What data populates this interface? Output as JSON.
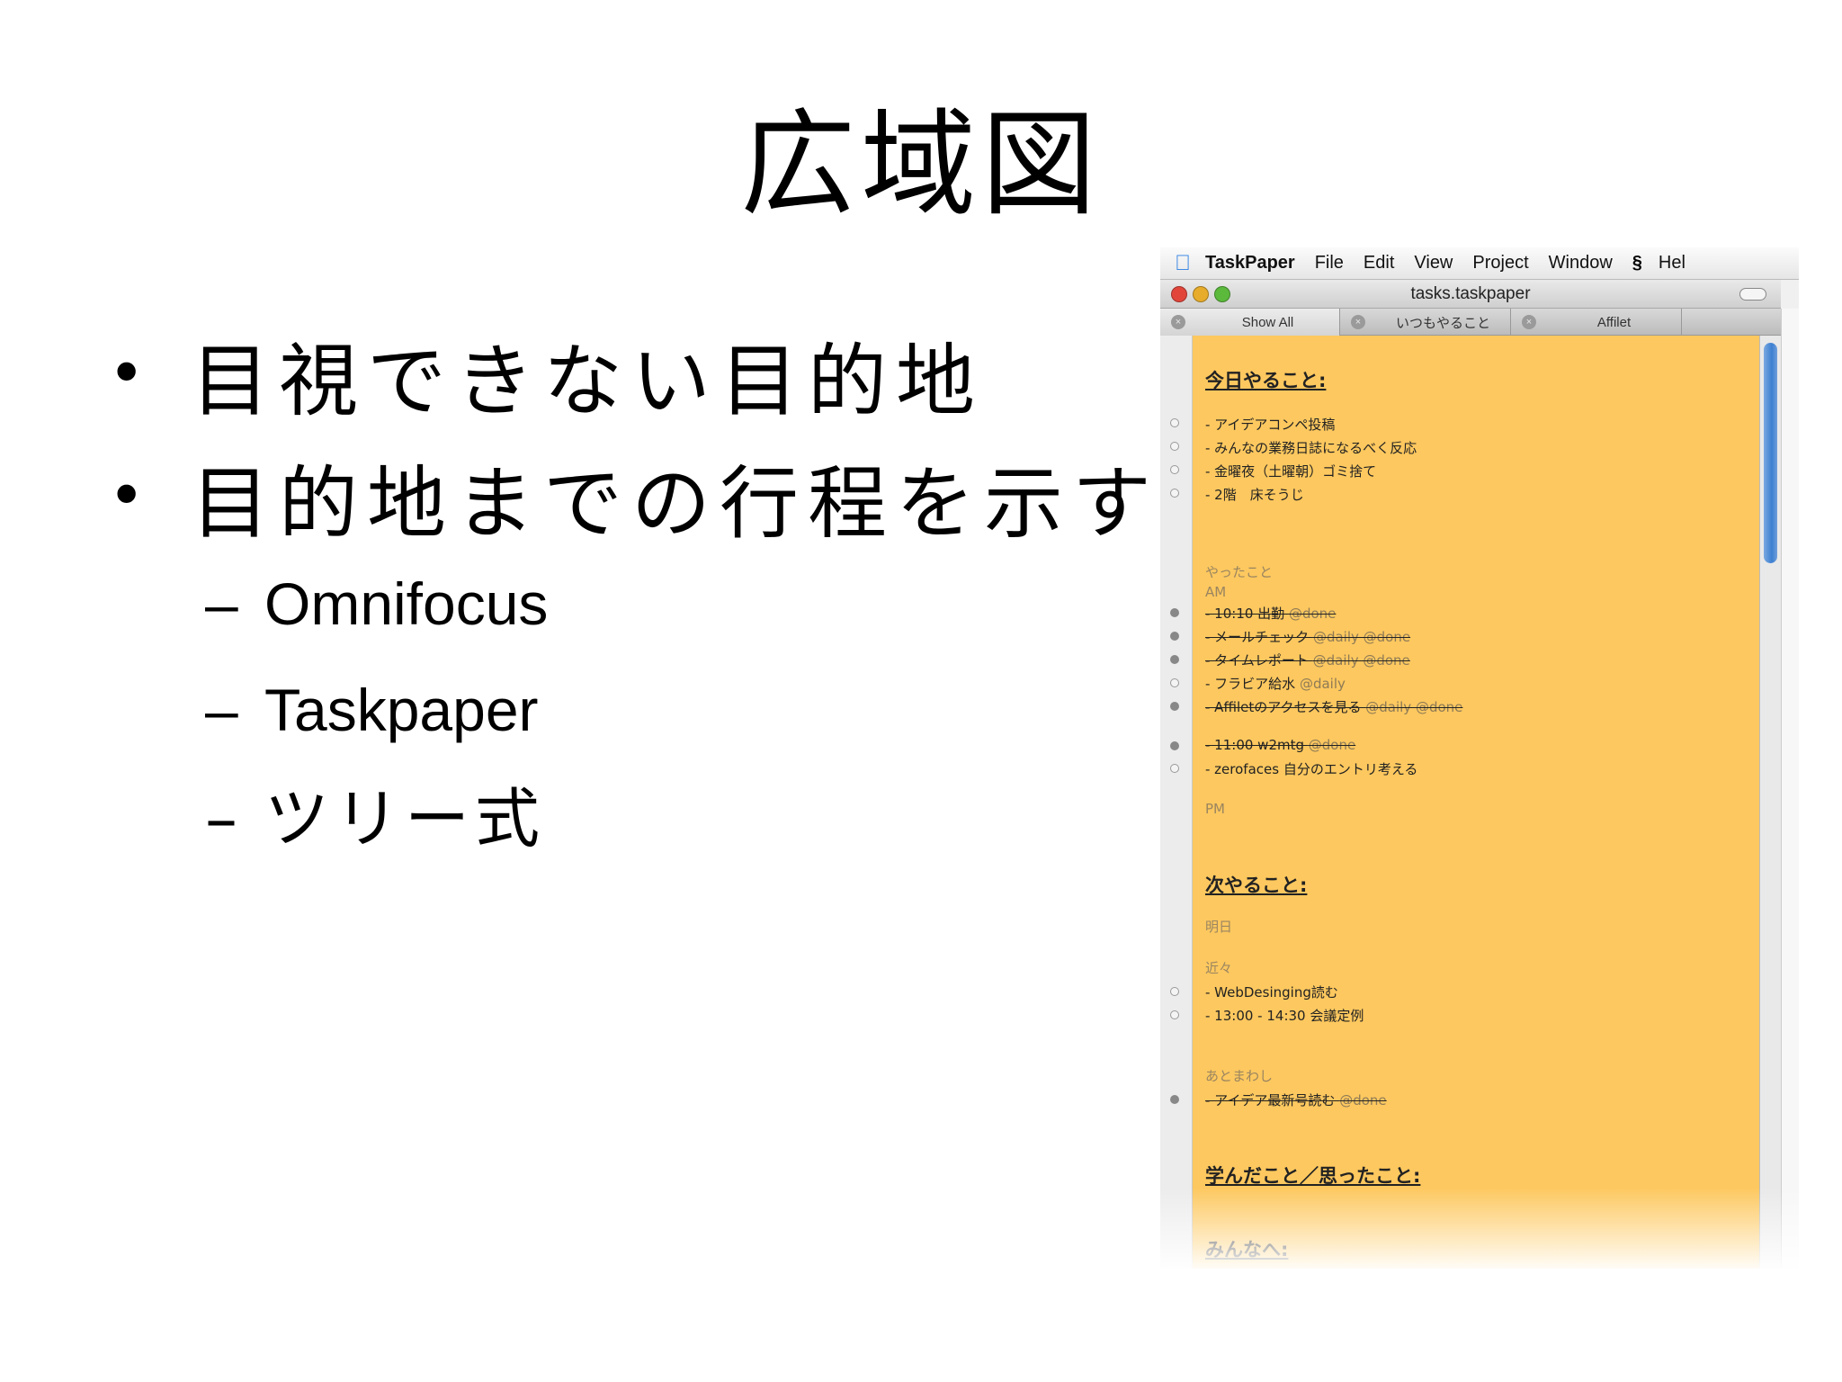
{
  "slide": {
    "title": "広域図",
    "bullets": [
      "目視できない目的地",
      "目的地までの行程を示す"
    ],
    "bullet_glyph": "•",
    "dash_glyph": "–",
    "subitems": [
      "Omnifocus",
      "Taskpaper",
      "ツリー式"
    ]
  },
  "app": {
    "menu": [
      "TaskPaper",
      "File",
      "Edit",
      "View",
      "Project",
      "Window",
      "Hel"
    ],
    "window_title": "tasks.taskpaper",
    "tabs": [
      "Show All",
      "いつもやること",
      "Affilet"
    ]
  },
  "doc": {
    "today_project": "今日やること:",
    "today_tasks": [
      "- アイデアコンペ投稿",
      "- みんなの業務日誌になるべく反応",
      "- 金曜夜（土曜朝）ゴミ捨て",
      "- 2階　床そうじ"
    ],
    "did_note": "やったこと",
    "am_note": "AM",
    "t1": "- 10:10 出勤 ",
    "t1_tag": "@done",
    "t2": "- メールチェック ",
    "t2_tag": "@daily @done",
    "t3": "- タイムレポート ",
    "t3_tag": "@daily @done",
    "t4": "- フラビア給水 ",
    "t4_tag": "@daily",
    "t5": "- Affiletのアクセスを見る ",
    "t5_tag": "@daily @done",
    "t6": "- 11:00 w2mtg ",
    "t6_tag": "@done",
    "t7": "- zerofaces 自分のエントリ考える",
    "pm_note": "PM",
    "next_project": "次やること:",
    "tomorrow_note": "明日",
    "soon_note": "近々",
    "n1": "- WebDesinging読む",
    "n2": "- 13:00 - 14:30 会議定例",
    "later_note": "あとまわし",
    "l1": "- アイデア最新号読む ",
    "l1_tag": "@done",
    "learn_project": "学んだこと／思ったこと:",
    "everyone_project": "みんなへ:"
  }
}
